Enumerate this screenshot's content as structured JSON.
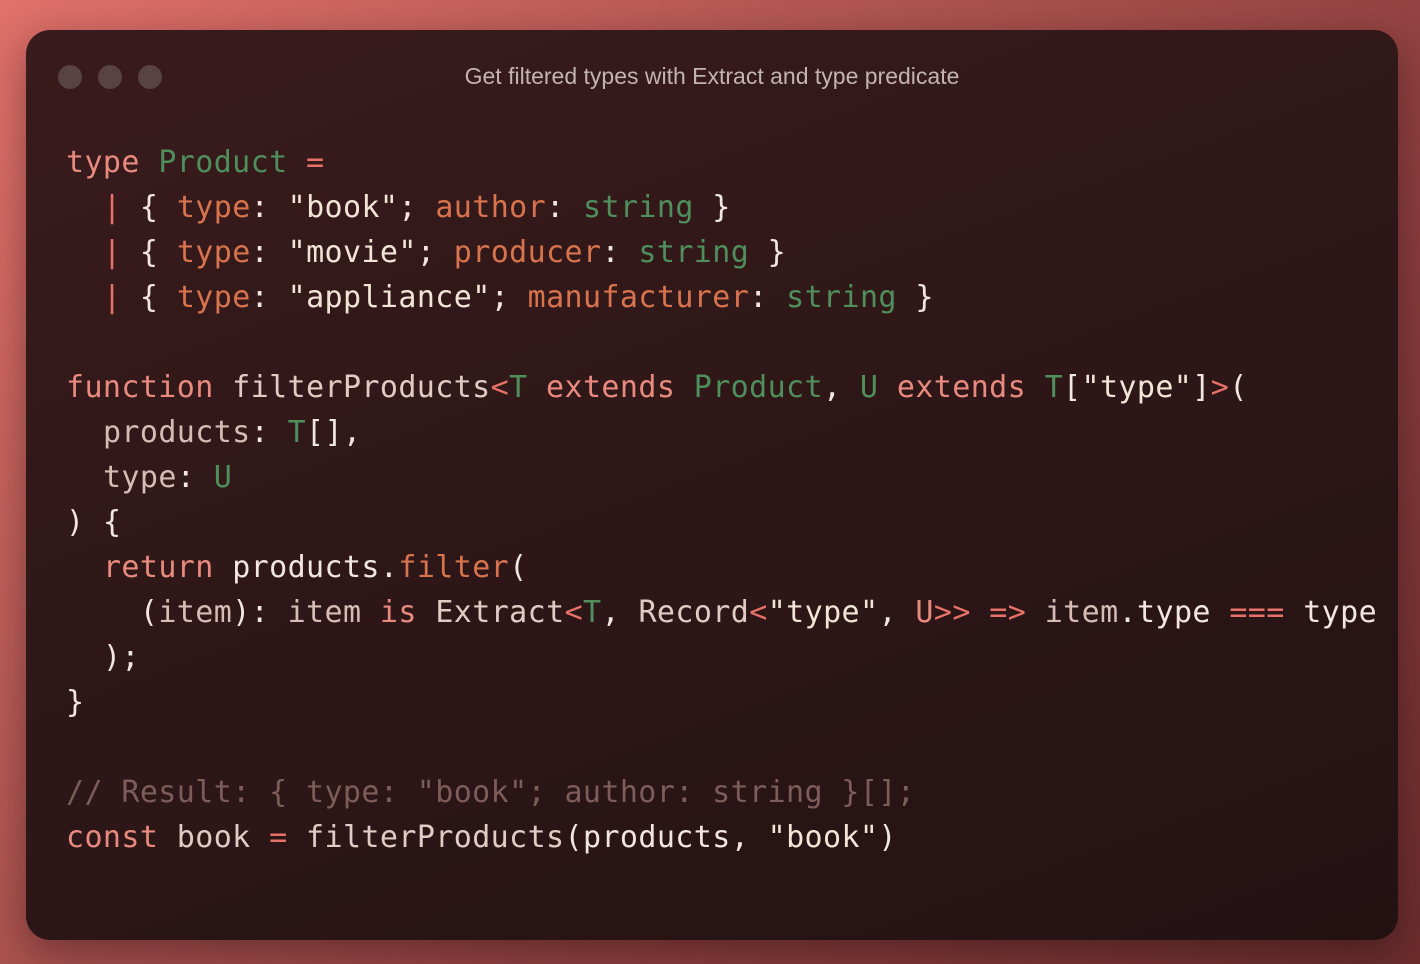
{
  "window": {
    "title": "Get filtered types with Extract and type predicate"
  },
  "code": {
    "lines": [
      [
        [
          "kw",
          "type"
        ],
        [
          "pl",
          " "
        ],
        [
          "ty",
          "Product"
        ],
        [
          "pl",
          " "
        ],
        [
          "op",
          "="
        ]
      ],
      [
        [
          "pl",
          "  "
        ],
        [
          "op",
          "|"
        ],
        [
          "pl",
          " "
        ],
        [
          "pu",
          "{"
        ],
        [
          "pl",
          " "
        ],
        [
          "pr",
          "type"
        ],
        [
          "pu",
          ":"
        ],
        [
          "pl",
          " "
        ],
        [
          "st",
          "\"book\""
        ],
        [
          "pu",
          ";"
        ],
        [
          "pl",
          " "
        ],
        [
          "pr",
          "author"
        ],
        [
          "pu",
          ":"
        ],
        [
          "pl",
          " "
        ],
        [
          "ty",
          "string"
        ],
        [
          "pl",
          " "
        ],
        [
          "pu",
          "}"
        ]
      ],
      [
        [
          "pl",
          "  "
        ],
        [
          "op",
          "|"
        ],
        [
          "pl",
          " "
        ],
        [
          "pu",
          "{"
        ],
        [
          "pl",
          " "
        ],
        [
          "pr",
          "type"
        ],
        [
          "pu",
          ":"
        ],
        [
          "pl",
          " "
        ],
        [
          "st",
          "\"movie\""
        ],
        [
          "pu",
          ";"
        ],
        [
          "pl",
          " "
        ],
        [
          "pr",
          "producer"
        ],
        [
          "pu",
          ":"
        ],
        [
          "pl",
          " "
        ],
        [
          "ty",
          "string"
        ],
        [
          "pl",
          " "
        ],
        [
          "pu",
          "}"
        ]
      ],
      [
        [
          "pl",
          "  "
        ],
        [
          "op",
          "|"
        ],
        [
          "pl",
          " "
        ],
        [
          "pu",
          "{"
        ],
        [
          "pl",
          " "
        ],
        [
          "pr",
          "type"
        ],
        [
          "pu",
          ":"
        ],
        [
          "pl",
          " "
        ],
        [
          "st",
          "\"appliance\""
        ],
        [
          "pu",
          ";"
        ],
        [
          "pl",
          " "
        ],
        [
          "pr",
          "manufacturer"
        ],
        [
          "pu",
          ":"
        ],
        [
          "pl",
          " "
        ],
        [
          "ty",
          "string"
        ],
        [
          "pl",
          " "
        ],
        [
          "pu",
          "}"
        ]
      ],
      [],
      [
        [
          "kw",
          "function"
        ],
        [
          "pl",
          " "
        ],
        [
          "fn",
          "filterProducts"
        ],
        [
          "op",
          "<"
        ],
        [
          "ty",
          "T"
        ],
        [
          "pl",
          " "
        ],
        [
          "kw",
          "extends"
        ],
        [
          "pl",
          " "
        ],
        [
          "ty",
          "Product"
        ],
        [
          "pu",
          ","
        ],
        [
          "pl",
          " "
        ],
        [
          "ty",
          "U"
        ],
        [
          "pl",
          " "
        ],
        [
          "kw",
          "extends"
        ],
        [
          "pl",
          " "
        ],
        [
          "ty",
          "T"
        ],
        [
          "pu",
          "["
        ],
        [
          "st",
          "\"type\""
        ],
        [
          "pu",
          "]"
        ],
        [
          "op",
          ">"
        ],
        [
          "pu",
          "("
        ]
      ],
      [
        [
          "pl",
          "  "
        ],
        [
          "pa",
          "products"
        ],
        [
          "pu",
          ":"
        ],
        [
          "pl",
          " "
        ],
        [
          "ty",
          "T"
        ],
        [
          "pu",
          "[],"
        ]
      ],
      [
        [
          "pl",
          "  "
        ],
        [
          "pa",
          "type"
        ],
        [
          "pu",
          ":"
        ],
        [
          "pl",
          " "
        ],
        [
          "ty",
          "U"
        ]
      ],
      [
        [
          "pu",
          ")"
        ],
        [
          "pl",
          " "
        ],
        [
          "pu",
          "{"
        ]
      ],
      [
        [
          "pl",
          "  "
        ],
        [
          "kw",
          "return"
        ],
        [
          "pl",
          " "
        ],
        [
          "pl",
          "products"
        ],
        [
          "pu",
          "."
        ],
        [
          "me",
          "filter"
        ],
        [
          "pu",
          "("
        ]
      ],
      [
        [
          "pl",
          "    "
        ],
        [
          "pu",
          "("
        ],
        [
          "pa",
          "item"
        ],
        [
          "pu",
          "):"
        ],
        [
          "pl",
          " "
        ],
        [
          "pa",
          "item"
        ],
        [
          "pl",
          " "
        ],
        [
          "kw",
          "is"
        ],
        [
          "pl",
          " "
        ],
        [
          "fn",
          "Extract"
        ],
        [
          "op",
          "<"
        ],
        [
          "ty",
          "T"
        ],
        [
          "pu",
          ","
        ],
        [
          "pl",
          " "
        ],
        [
          "fn",
          "Record"
        ],
        [
          "op",
          "<"
        ],
        [
          "st",
          "\"type\""
        ],
        [
          "pu",
          ","
        ],
        [
          "pl",
          " "
        ],
        [
          "kw",
          "U"
        ],
        [
          "op",
          ">>"
        ],
        [
          "pl",
          " "
        ],
        [
          "op",
          "=>"
        ],
        [
          "pl",
          " "
        ],
        [
          "pa",
          "item"
        ],
        [
          "pu",
          "."
        ],
        [
          "pl",
          "type"
        ],
        [
          "pl",
          " "
        ],
        [
          "op",
          "==="
        ],
        [
          "pl",
          " "
        ],
        [
          "pl",
          "type"
        ]
      ],
      [
        [
          "pl",
          "  "
        ],
        [
          "pu",
          ");"
        ]
      ],
      [
        [
          "pu",
          "}"
        ]
      ],
      [],
      [
        [
          "cm",
          "// Result: { type: \"book\"; author: string }[];"
        ]
      ],
      [
        [
          "kw",
          "const"
        ],
        [
          "pl",
          " "
        ],
        [
          "fn",
          "book"
        ],
        [
          "pl",
          " "
        ],
        [
          "op",
          "="
        ],
        [
          "pl",
          " "
        ],
        [
          "fn",
          "filterProducts"
        ],
        [
          "pu",
          "("
        ],
        [
          "pl",
          "products"
        ],
        [
          "pu",
          ","
        ],
        [
          "pl",
          " "
        ],
        [
          "st",
          "\"book\""
        ],
        [
          "pu",
          ")"
        ]
      ]
    ]
  }
}
